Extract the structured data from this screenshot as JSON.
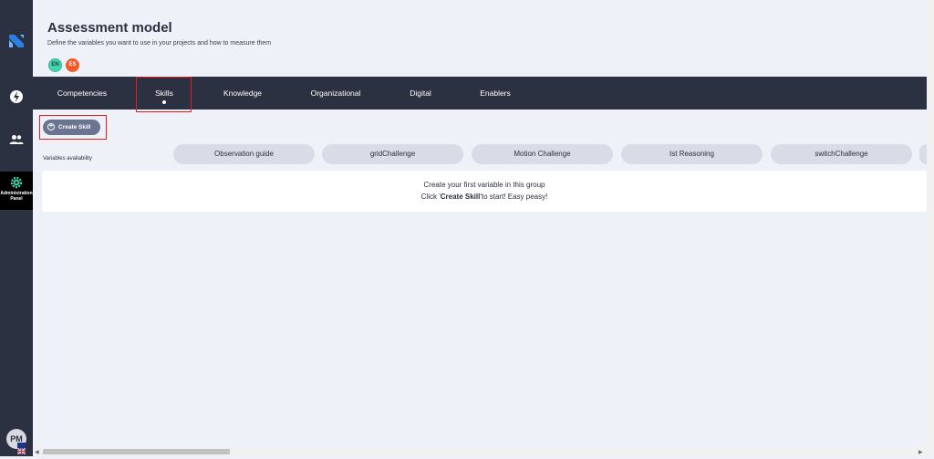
{
  "header": {
    "title": "Assessment model",
    "subtitle": "Define the variables you want to use in your projects and how to measure them",
    "languages": [
      "EN",
      "ES"
    ]
  },
  "sidebar": {
    "icons": [
      "logo-icon",
      "bolt-icon",
      "users-icon",
      "gear-icon"
    ],
    "admin_label_line1": "Administration",
    "admin_label_line2": "Panel",
    "avatar_initials": "PM"
  },
  "tabs": [
    {
      "label": "Competencies"
    },
    {
      "label": "Skills",
      "active": true
    },
    {
      "label": "Knowledge"
    },
    {
      "label": "Organizational"
    },
    {
      "label": "Digital"
    },
    {
      "label": "Enablers"
    }
  ],
  "toolbar": {
    "create_label": "Create Skill"
  },
  "variables": {
    "label": "Variables availability",
    "chips": [
      "Observation guide",
      "gridChallenge",
      "Motion Challenge",
      "Ist Reasoning",
      "switchChallenge"
    ]
  },
  "empty_state": {
    "line1": "Create your first variable in this group",
    "line2_prefix": "Click '",
    "line2_bold": "Create Skill",
    "line2_suffix": "'to start! Easy peasy!"
  },
  "colors": {
    "sidebar": "#2b3140",
    "tabs_bar": "#2b3140",
    "background": "#eef1f8",
    "create_button": "#6b7591",
    "chip": "#d8dce6",
    "highlight": "#e02020"
  }
}
